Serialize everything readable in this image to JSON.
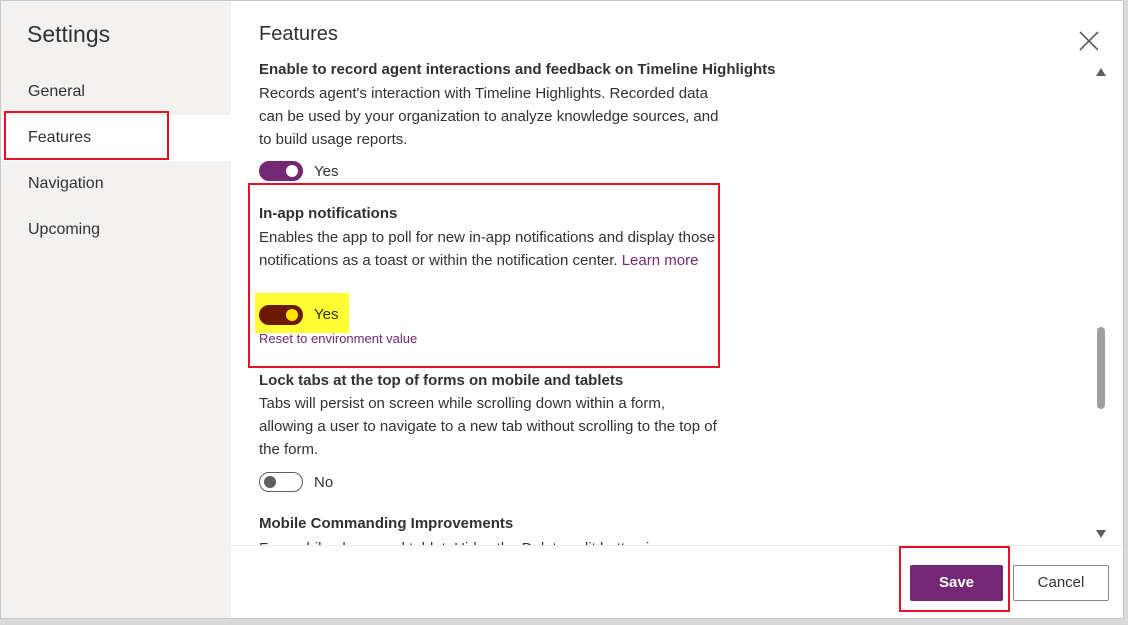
{
  "sidebar": {
    "title": "Settings",
    "items": [
      {
        "label": "General"
      },
      {
        "label": "Features"
      },
      {
        "label": "Navigation"
      },
      {
        "label": "Upcoming"
      }
    ],
    "selected": "Features"
  },
  "main": {
    "title": "Features",
    "settings": [
      {
        "heading": "Enable to record agent interactions and feedback on Timeline Highlights",
        "description": "Records agent's interaction with Timeline Highlights. Recorded data can be used by your organization to analyze knowledge sources, and to build usage reports.",
        "toggle_state": "on",
        "toggle_label": "Yes"
      },
      {
        "heading": "In-app notifications",
        "description": "Enables the app to poll for new in-app notifications and display those notifications as a toast or within the notification center.",
        "link_text": "Learn more",
        "toggle_state": "on",
        "toggle_label": "Yes",
        "reset_link": "Reset to environment value"
      },
      {
        "heading": "Lock tabs at the top of forms on mobile and tablets",
        "description": "Tabs will persist on screen while scrolling down within a form, allowing a user to navigate to a new tab without scrolling to the top of the form.",
        "toggle_state": "off",
        "toggle_label": "No"
      },
      {
        "heading": "Mobile Commanding Improvements",
        "description": "For mobile phone and tablet: Hides the Delete split button in"
      }
    ]
  },
  "footer": {
    "save_label": "Save",
    "cancel_label": "Cancel"
  },
  "colors": {
    "accent": "#742774",
    "highlight_box": "#e81123",
    "highlight_marker": "#ffff33"
  },
  "icons": {
    "close": "close-icon",
    "scroll_up": "caret-up-icon",
    "scroll_down": "caret-down-icon"
  }
}
